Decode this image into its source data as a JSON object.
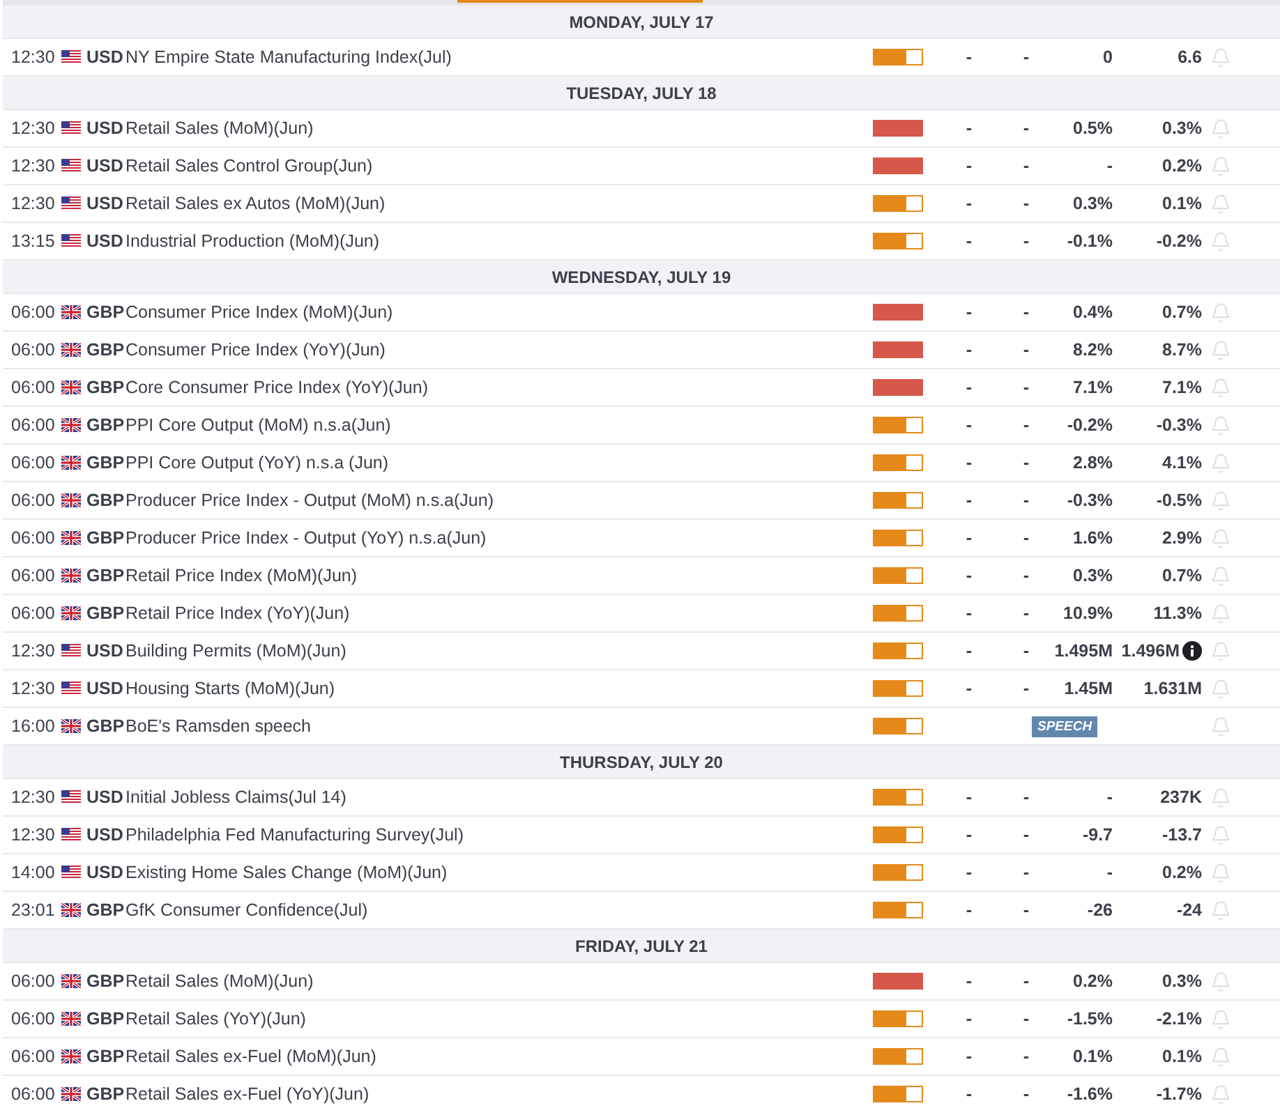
{
  "days": [
    {
      "label": "MONDAY, JULY 17",
      "events": [
        {
          "time": "12:30",
          "flag": {
            "kind": "us"
          },
          "currency": "USD",
          "title": "NY Empire State Manufacturing Index(Jul)",
          "impact": {
            "kind": "medium"
          },
          "kind": "data",
          "actual": "-",
          "deviation": "-",
          "consensus": "0",
          "previous": "6.6",
          "info": false
        }
      ]
    },
    {
      "label": "TUESDAY, JULY 18",
      "events": [
        {
          "time": "12:30",
          "flag": {
            "kind": "us"
          },
          "currency": "USD",
          "title": "Retail Sales (MoM)(Jun)",
          "impact": {
            "kind": "high"
          },
          "kind": "data",
          "actual": "-",
          "deviation": "-",
          "consensus": "0.5%",
          "previous": "0.3%",
          "info": false
        },
        {
          "time": "12:30",
          "flag": {
            "kind": "us"
          },
          "currency": "USD",
          "title": "Retail Sales Control Group(Jun)",
          "impact": {
            "kind": "high"
          },
          "kind": "data",
          "actual": "-",
          "deviation": "-",
          "consensus": "-",
          "previous": "0.2%",
          "info": false
        },
        {
          "time": "12:30",
          "flag": {
            "kind": "us"
          },
          "currency": "USD",
          "title": "Retail Sales ex Autos (MoM)(Jun)",
          "impact": {
            "kind": "medium"
          },
          "kind": "data",
          "actual": "-",
          "deviation": "-",
          "consensus": "0.3%",
          "previous": "0.1%",
          "info": false
        },
        {
          "time": "13:15",
          "flag": {
            "kind": "us"
          },
          "currency": "USD",
          "title": "Industrial Production (MoM)(Jun)",
          "impact": {
            "kind": "medium"
          },
          "kind": "data",
          "actual": "-",
          "deviation": "-",
          "consensus": "-0.1%",
          "previous": "-0.2%",
          "info": false
        }
      ]
    },
    {
      "label": "WEDNESDAY, JULY 19",
      "events": [
        {
          "time": "06:00",
          "flag": {
            "kind": "gb"
          },
          "currency": "GBP",
          "title": "Consumer Price Index (MoM)(Jun)",
          "impact": {
            "kind": "high"
          },
          "kind": "data",
          "actual": "-",
          "deviation": "-",
          "consensus": "0.4%",
          "previous": "0.7%",
          "info": false
        },
        {
          "time": "06:00",
          "flag": {
            "kind": "gb"
          },
          "currency": "GBP",
          "title": "Consumer Price Index (YoY)(Jun)",
          "impact": {
            "kind": "high"
          },
          "kind": "data",
          "actual": "-",
          "deviation": "-",
          "consensus": "8.2%",
          "previous": "8.7%",
          "info": false
        },
        {
          "time": "06:00",
          "flag": {
            "kind": "gb"
          },
          "currency": "GBP",
          "title": "Core Consumer Price Index (YoY)(Jun)",
          "impact": {
            "kind": "high"
          },
          "kind": "data",
          "actual": "-",
          "deviation": "-",
          "consensus": "7.1%",
          "previous": "7.1%",
          "info": false
        },
        {
          "time": "06:00",
          "flag": {
            "kind": "gb"
          },
          "currency": "GBP",
          "title": "PPI Core Output (MoM) n.s.a(Jun)",
          "impact": {
            "kind": "medium"
          },
          "kind": "data",
          "actual": "-",
          "deviation": "-",
          "consensus": "-0.2%",
          "previous": "-0.3%",
          "info": false
        },
        {
          "time": "06:00",
          "flag": {
            "kind": "gb"
          },
          "currency": "GBP",
          "title": "PPI Core Output (YoY) n.s.a (Jun)",
          "impact": {
            "kind": "medium"
          },
          "kind": "data",
          "actual": "-",
          "deviation": "-",
          "consensus": "2.8%",
          "previous": "4.1%",
          "info": false
        },
        {
          "time": "06:00",
          "flag": {
            "kind": "gb"
          },
          "currency": "GBP",
          "title": "Producer Price Index - Output (MoM) n.s.a(Jun)",
          "impact": {
            "kind": "medium"
          },
          "kind": "data",
          "actual": "-",
          "deviation": "-",
          "consensus": "-0.3%",
          "previous": "-0.5%",
          "info": false
        },
        {
          "time": "06:00",
          "flag": {
            "kind": "gb"
          },
          "currency": "GBP",
          "title": "Producer Price Index - Output (YoY) n.s.a(Jun)",
          "impact": {
            "kind": "medium"
          },
          "kind": "data",
          "actual": "-",
          "deviation": "-",
          "consensus": "1.6%",
          "previous": "2.9%",
          "info": false
        },
        {
          "time": "06:00",
          "flag": {
            "kind": "gb"
          },
          "currency": "GBP",
          "title": "Retail Price Index (MoM)(Jun)",
          "impact": {
            "kind": "medium"
          },
          "kind": "data",
          "actual": "-",
          "deviation": "-",
          "consensus": "0.3%",
          "previous": "0.7%",
          "info": false
        },
        {
          "time": "06:00",
          "flag": {
            "kind": "gb"
          },
          "currency": "GBP",
          "title": "Retail Price Index (YoY)(Jun)",
          "impact": {
            "kind": "medium"
          },
          "kind": "data",
          "actual": "-",
          "deviation": "-",
          "consensus": "10.9%",
          "previous": "11.3%",
          "info": false
        },
        {
          "time": "12:30",
          "flag": {
            "kind": "us"
          },
          "currency": "USD",
          "title": "Building Permits (MoM)(Jun)",
          "impact": {
            "kind": "medium"
          },
          "kind": "data",
          "actual": "-",
          "deviation": "-",
          "consensus": "1.495M",
          "previous": "1.496M",
          "info": true
        },
        {
          "time": "12:30",
          "flag": {
            "kind": "us"
          },
          "currency": "USD",
          "title": "Housing Starts (MoM)(Jun)",
          "impact": {
            "kind": "medium"
          },
          "kind": "data",
          "actual": "-",
          "deviation": "-",
          "consensus": "1.45M",
          "previous": "1.631M",
          "info": false
        },
        {
          "time": "16:00",
          "flag": {
            "kind": "gb"
          },
          "currency": "GBP",
          "title": "BoE's Ramsden speech",
          "impact": {
            "kind": "medium"
          },
          "kind": "speech",
          "badge": "SPEECH",
          "info": false
        }
      ]
    },
    {
      "label": "THURSDAY, JULY 20",
      "events": [
        {
          "time": "12:30",
          "flag": {
            "kind": "us"
          },
          "currency": "USD",
          "title": "Initial Jobless Claims(Jul 14)",
          "impact": {
            "kind": "medium"
          },
          "kind": "data",
          "actual": "-",
          "deviation": "-",
          "consensus": "-",
          "previous": "237K",
          "info": false
        },
        {
          "time": "12:30",
          "flag": {
            "kind": "us"
          },
          "currency": "USD",
          "title": "Philadelphia Fed Manufacturing Survey(Jul)",
          "impact": {
            "kind": "medium"
          },
          "kind": "data",
          "actual": "-",
          "deviation": "-",
          "consensus": "-9.7",
          "previous": "-13.7",
          "info": false
        },
        {
          "time": "14:00",
          "flag": {
            "kind": "us"
          },
          "currency": "USD",
          "title": "Existing Home Sales Change (MoM)(Jun)",
          "impact": {
            "kind": "medium"
          },
          "kind": "data",
          "actual": "-",
          "deviation": "-",
          "consensus": "-",
          "previous": "0.2%",
          "info": false
        },
        {
          "time": "23:01",
          "flag": {
            "kind": "gb"
          },
          "currency": "GBP",
          "title": "GfK Consumer Confidence(Jul)",
          "impact": {
            "kind": "medium"
          },
          "kind": "data",
          "actual": "-",
          "deviation": "-",
          "consensus": "-26",
          "previous": "-24",
          "info": false
        }
      ]
    },
    {
      "label": "FRIDAY, JULY 21",
      "events": [
        {
          "time": "06:00",
          "flag": {
            "kind": "gb"
          },
          "currency": "GBP",
          "title": "Retail Sales (MoM)(Jun)",
          "impact": {
            "kind": "high"
          },
          "kind": "data",
          "actual": "-",
          "deviation": "-",
          "consensus": "0.2%",
          "previous": "0.3%",
          "info": false
        },
        {
          "time": "06:00",
          "flag": {
            "kind": "gb"
          },
          "currency": "GBP",
          "title": "Retail Sales (YoY)(Jun)",
          "impact": {
            "kind": "medium"
          },
          "kind": "data",
          "actual": "-",
          "deviation": "-",
          "consensus": "-1.5%",
          "previous": "-2.1%",
          "info": false
        },
        {
          "time": "06:00",
          "flag": {
            "kind": "gb"
          },
          "currency": "GBP",
          "title": "Retail Sales ex-Fuel (MoM)(Jun)",
          "impact": {
            "kind": "medium"
          },
          "kind": "data",
          "actual": "-",
          "deviation": "-",
          "consensus": "0.1%",
          "previous": "0.1%",
          "info": false
        },
        {
          "time": "06:00",
          "flag": {
            "kind": "gb"
          },
          "currency": "GBP",
          "title": "Retail Sales ex-Fuel (YoY)(Jun)",
          "impact": {
            "kind": "medium"
          },
          "kind": "data",
          "actual": "-",
          "deviation": "-",
          "consensus": "-1.6%",
          "previous": "-1.7%",
          "info": false
        }
      ]
    }
  ]
}
